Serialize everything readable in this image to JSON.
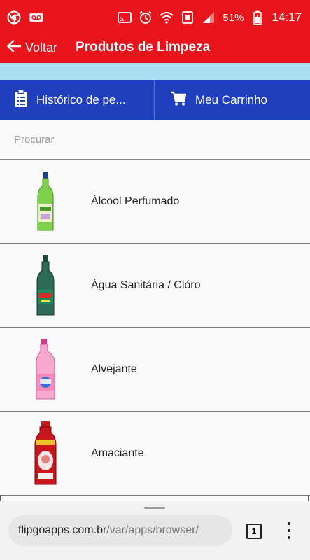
{
  "status_bar": {
    "time": "14:17",
    "battery_percent": "51%",
    "icons": [
      "chrome-icon",
      "voicemail-icon",
      "cast-icon",
      "alarm-icon",
      "wifi-icon",
      "nfc-icon",
      "signal-icon",
      "battery-icon"
    ]
  },
  "app_bar": {
    "back_label": "Voltar",
    "title": "Produtos de Limpeza"
  },
  "tabs": [
    {
      "label": "Histórico de pe...",
      "icon": "clipboard-icon"
    },
    {
      "label": "Meu Carrinho",
      "icon": "cart-icon"
    }
  ],
  "search": {
    "placeholder": "Procurar",
    "value": ""
  },
  "products": [
    {
      "name": "Álcool Perfumado",
      "icon": "green-bottle-icon"
    },
    {
      "name": "Água Sanitária / Clóro",
      "icon": "dark-green-bottle-icon"
    },
    {
      "name": "Alvejante",
      "icon": "pink-bottle-icon"
    },
    {
      "name": "Amaciante",
      "icon": "red-bottle-icon"
    }
  ],
  "browser_bar": {
    "url_host": "flipgoapps.com.br",
    "url_path": "/var/apps/browser/",
    "tab_count": "1"
  },
  "colors": {
    "primary_red": "#e8141c",
    "tab_blue": "#1f3fbf",
    "accent_light_blue": "#a9dff1"
  }
}
